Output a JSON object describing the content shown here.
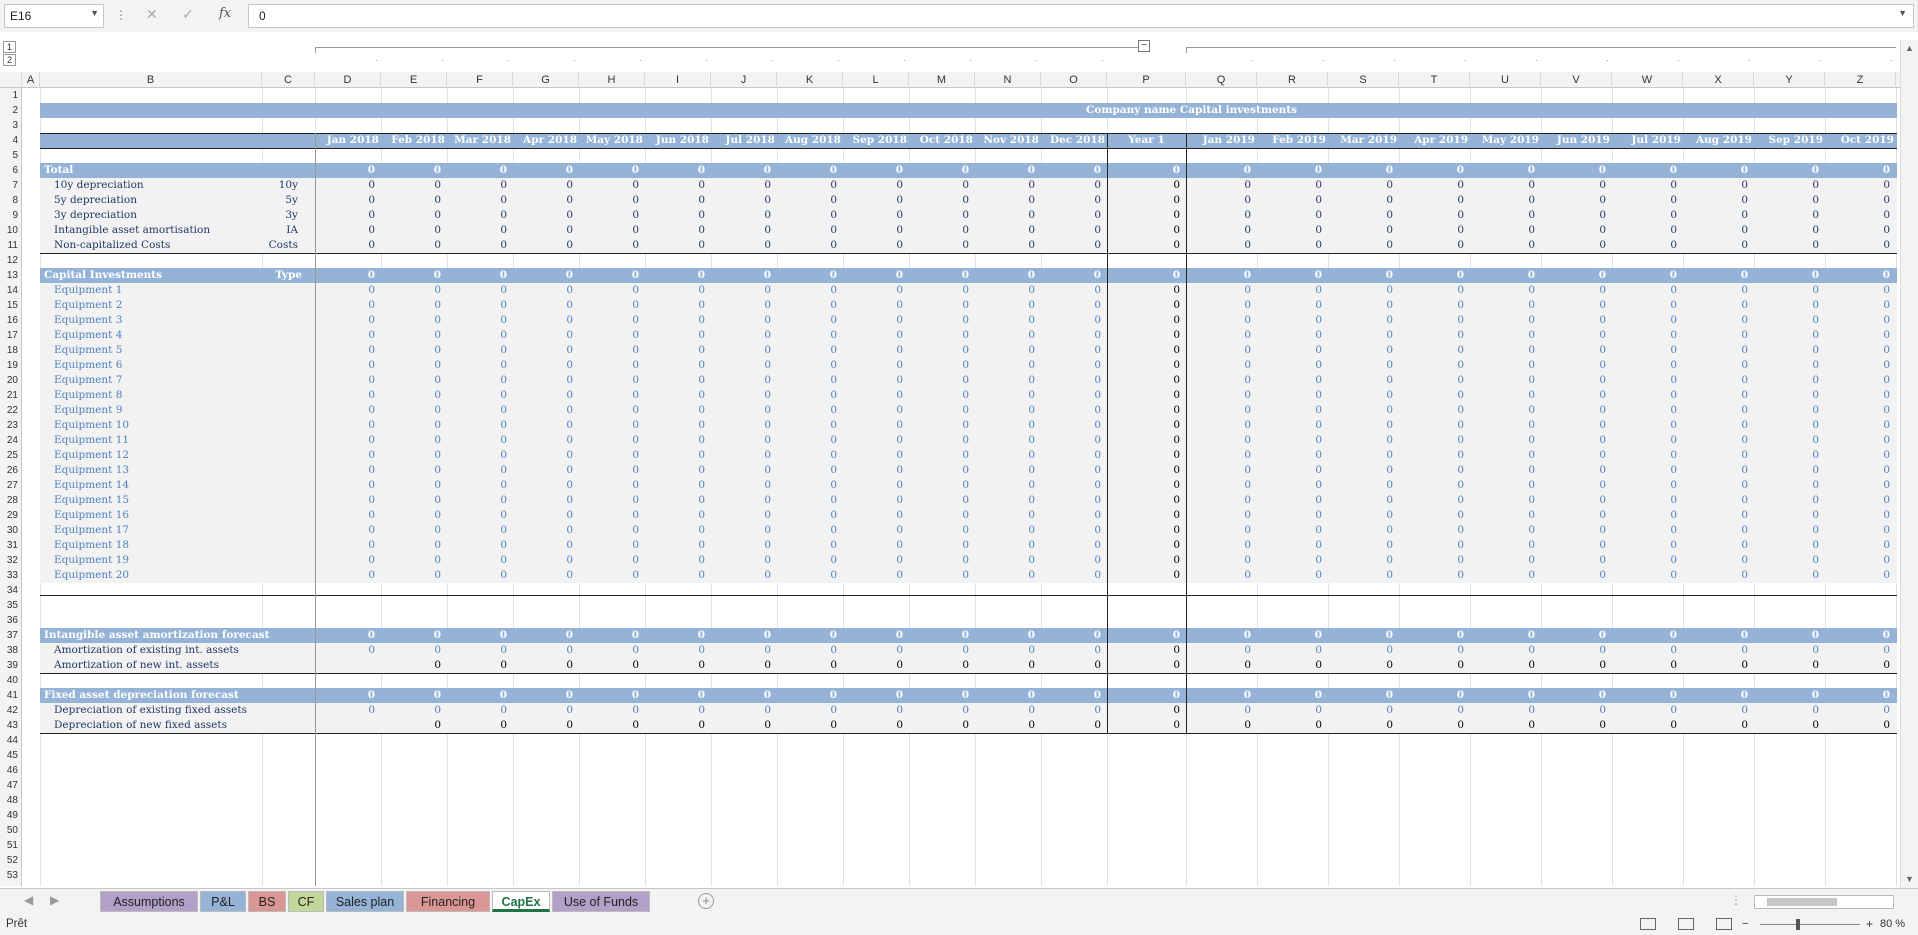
{
  "formula_bar": {
    "name_box": "E16",
    "formula": "0"
  },
  "outline": {
    "levels": [
      "1",
      "2"
    ],
    "collapse_symbol": "−"
  },
  "columns": [
    "A",
    "B",
    "C",
    "D",
    "E",
    "F",
    "G",
    "H",
    "I",
    "J",
    "K",
    "L",
    "M",
    "N",
    "O",
    "P",
    "Q",
    "R",
    "S",
    "T",
    "U",
    "V",
    "W",
    "X",
    "Y",
    "Z"
  ],
  "title": "Company name Capital investments",
  "periods_y1": [
    "Jan 2018",
    "Feb 2018",
    "Mar 2018",
    "Apr 2018",
    "May 2018",
    "Jun 2018",
    "Jul 2018",
    "Aug 2018",
    "Sep 2018",
    "Oct 2018",
    "Nov 2018",
    "Dec 2018"
  ],
  "year_label": "Year 1",
  "periods_y2": [
    "Jan 2019",
    "Feb 2019",
    "Mar 2019",
    "Apr 2019",
    "May 2019",
    "Jun 2019",
    "Jul 2019",
    "Aug 2019",
    "Sep 2019",
    "Oct 2019"
  ],
  "total_section": {
    "header": "Total",
    "rows": [
      {
        "label": "10y depreciation",
        "code": "10y"
      },
      {
        "label": "5y depreciation",
        "code": "5y"
      },
      {
        "label": "3y depreciation",
        "code": "3y"
      },
      {
        "label": "Intangible asset amortisation",
        "code": "IA"
      },
      {
        "label": "Non-capitalized Costs",
        "code": "Costs"
      }
    ]
  },
  "capex_section": {
    "header": "Capital Investments",
    "type_label": "Type",
    "items": [
      "Equipment 1",
      "Equipment 2",
      "Equipment 3",
      "Equipment 4",
      "Equipment 5",
      "Equipment 6",
      "Equipment 7",
      "Equipment 8",
      "Equipment 9",
      "Equipment 10",
      "Equipment 11",
      "Equipment 12",
      "Equipment 13",
      "Equipment 14",
      "Equipment 15",
      "Equipment 16",
      "Equipment 17",
      "Equipment 18",
      "Equipment 19",
      "Equipment 20"
    ]
  },
  "intangible_section": {
    "header": "Intangible asset amortization forecast",
    "rows": [
      "Amortization of existing int. assets",
      "Amortization of new int. assets"
    ]
  },
  "fixed_section": {
    "header": "Fixed asset depreciation forecast",
    "rows": [
      "Depreciation of existing fixed assets",
      "Depreciation of new fixed assets"
    ]
  },
  "cell_value": "0",
  "sheet_tabs": [
    {
      "label": "Assumptions",
      "color": "#b1a0c7"
    },
    {
      "label": "P&L",
      "color": "#95b3d7"
    },
    {
      "label": "BS",
      "color": "#da9694"
    },
    {
      "label": "CF",
      "color": "#c4d79b"
    },
    {
      "label": "Sales plan",
      "color": "#95b3d7"
    },
    {
      "label": "Financing",
      "color": "#da9694"
    },
    {
      "label": "CapEx",
      "color": "#ffffff"
    },
    {
      "label": "Use of Funds",
      "color": "#b1a0c7"
    }
  ],
  "active_tab": "CapEx",
  "status": {
    "ready": "Prêt",
    "zoom": "80 %"
  },
  "colors": {
    "band": "#95b3d7",
    "dark_text": "#1f3864",
    "input_blue": "#4f81bd",
    "active_tab": "#217346"
  }
}
